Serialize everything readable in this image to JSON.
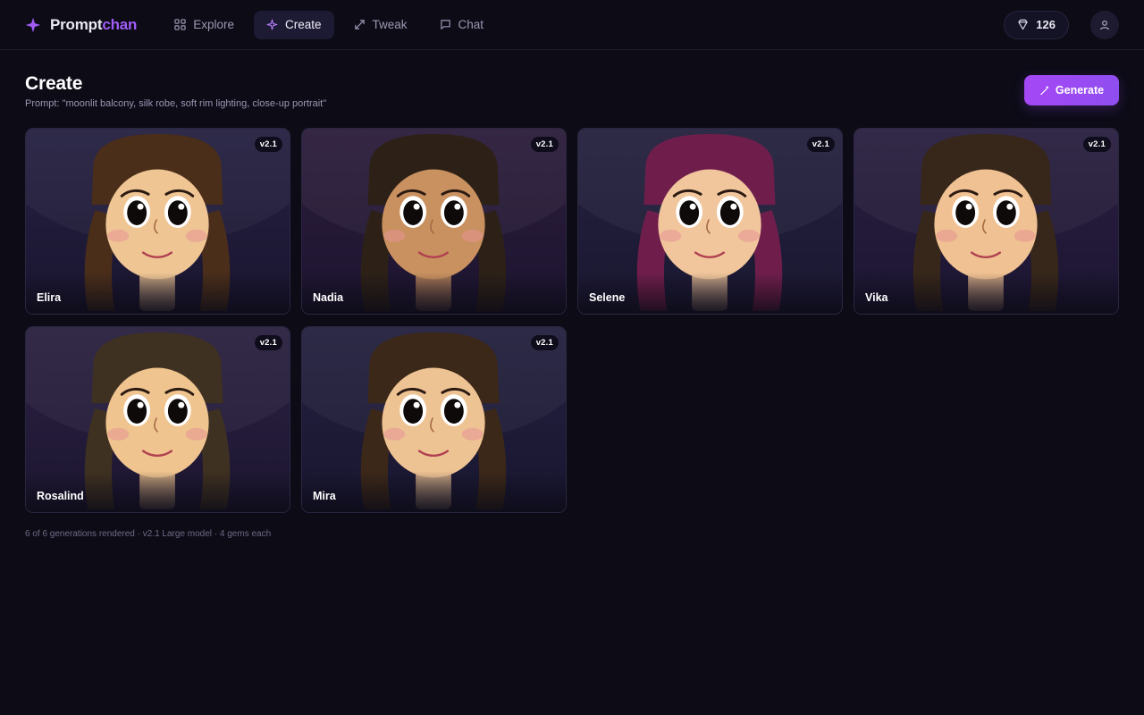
{
  "brand": {
    "name_part1": "Prompt",
    "name_part2": "chan"
  },
  "nav": [
    {
      "id": "explore",
      "label": "Explore",
      "icon": "grid-icon",
      "active": false
    },
    {
      "id": "create",
      "label": "Create",
      "icon": "sparkle-icon",
      "active": true
    },
    {
      "id": "tweak",
      "label": "Tweak",
      "icon": "expand-icon",
      "active": false
    },
    {
      "id": "chat",
      "label": "Chat",
      "icon": "chat-bubble-icon",
      "active": false
    }
  ],
  "header_right": {
    "gems_count": "126",
    "gems_icon": "gem-icon",
    "profile_icon": "user-icon"
  },
  "page": {
    "title": "Create",
    "prompt": "Prompt: \"moonlit balcony, silk robe, soft rim lighting, close-up portrait\"",
    "generate_label": "Generate"
  },
  "cards": [
    {
      "name": "Elira",
      "badge": "v2.1",
      "hair": "#4a2e1a",
      "skin": "#efc594",
      "bg_top": "#252141",
      "bg_bottom": "#1a1530"
    },
    {
      "name": "Nadia",
      "badge": "v2.1",
      "hair": "#2d2117",
      "skin": "#c99160",
      "bg_top": "#2c1e3b",
      "bg_bottom": "#1d1430"
    },
    {
      "name": "Selene",
      "badge": "v2.1",
      "hair": "#6f1e4c",
      "skin": "#f1c69c",
      "bg_top": "#25223f",
      "bg_bottom": "#1a1731"
    },
    {
      "name": "Vika",
      "badge": "v2.1",
      "hair": "#37271a",
      "skin": "#f0c192",
      "bg_top": "#2a2040",
      "bg_bottom": "#1c1532"
    },
    {
      "name": "Rosalind",
      "badge": "v2.1",
      "hair": "#3f3121",
      "skin": "#efc48f",
      "bg_top": "#2a2140",
      "bg_bottom": "#1d1632"
    },
    {
      "name": "Mira",
      "badge": "v2.1",
      "hair": "#3c2818",
      "skin": "#eec394",
      "bg_top": "#23213e",
      "bg_bottom": "#191631"
    }
  ],
  "footnote": "6 of 6 generations rendered · v2.1 Large model · 4 gems each",
  "colors": {
    "accent": "#a15cf6",
    "background": "#0c0b16",
    "nav_active_bg": "#1d1a33"
  }
}
